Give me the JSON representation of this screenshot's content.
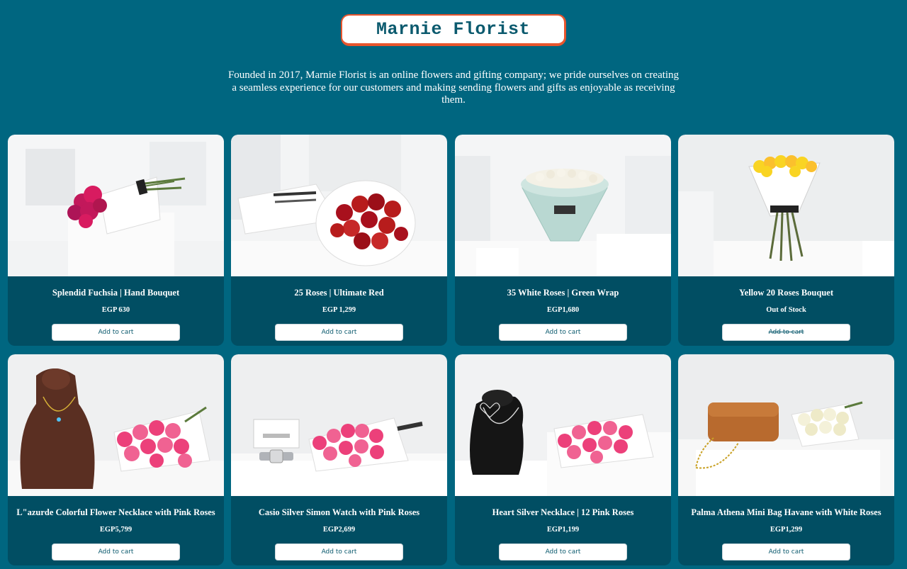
{
  "header": {
    "brand": "Marnie Florist",
    "intro": "Founded in 2017, Marnie Florist is an online flowers and gifting company; we pride ourselves on creating a seamless experience for our customers and making sending flowers and gifts as enjoyable as receiving them."
  },
  "colors": {
    "page_bg": "#006680",
    "card_bg": "#014e63",
    "logo_border": "#e8552d",
    "logo_text": "#0b5a6e"
  },
  "products": [
    {
      "title": "Splendid Fuchsia | Hand Bouquet",
      "price": "EGP 630",
      "button": "Add to cart",
      "in_stock": true
    },
    {
      "title": "25 Roses | Ultimate Red",
      "price": "EGP 1,299",
      "button": "Add to cart",
      "in_stock": true
    },
    {
      "title": "35 White Roses | Green Wrap",
      "price": "EGP1,680",
      "button": "Add to cart",
      "in_stock": true
    },
    {
      "title": "Yellow 20 Roses Bouquet",
      "price": "Out of Stock",
      "button": "Add to cart",
      "in_stock": false
    },
    {
      "title": "L\"azurde Colorful Flower Necklace with Pink Roses",
      "price": "EGP5,799",
      "button": "Add to cart",
      "in_stock": true
    },
    {
      "title": "Casio Silver Simon Watch with Pink Roses",
      "price": "EGP2,699",
      "button": "Add to cart",
      "in_stock": true
    },
    {
      "title": "Heart Silver Necklace | 12 Pink Roses",
      "price": "EGP1,199",
      "button": "Add to cart",
      "in_stock": true
    },
    {
      "title": "Palma Athena Mini Bag Havane with White Roses",
      "price": "EGP1,299",
      "button": "Add to cart",
      "in_stock": true
    }
  ]
}
